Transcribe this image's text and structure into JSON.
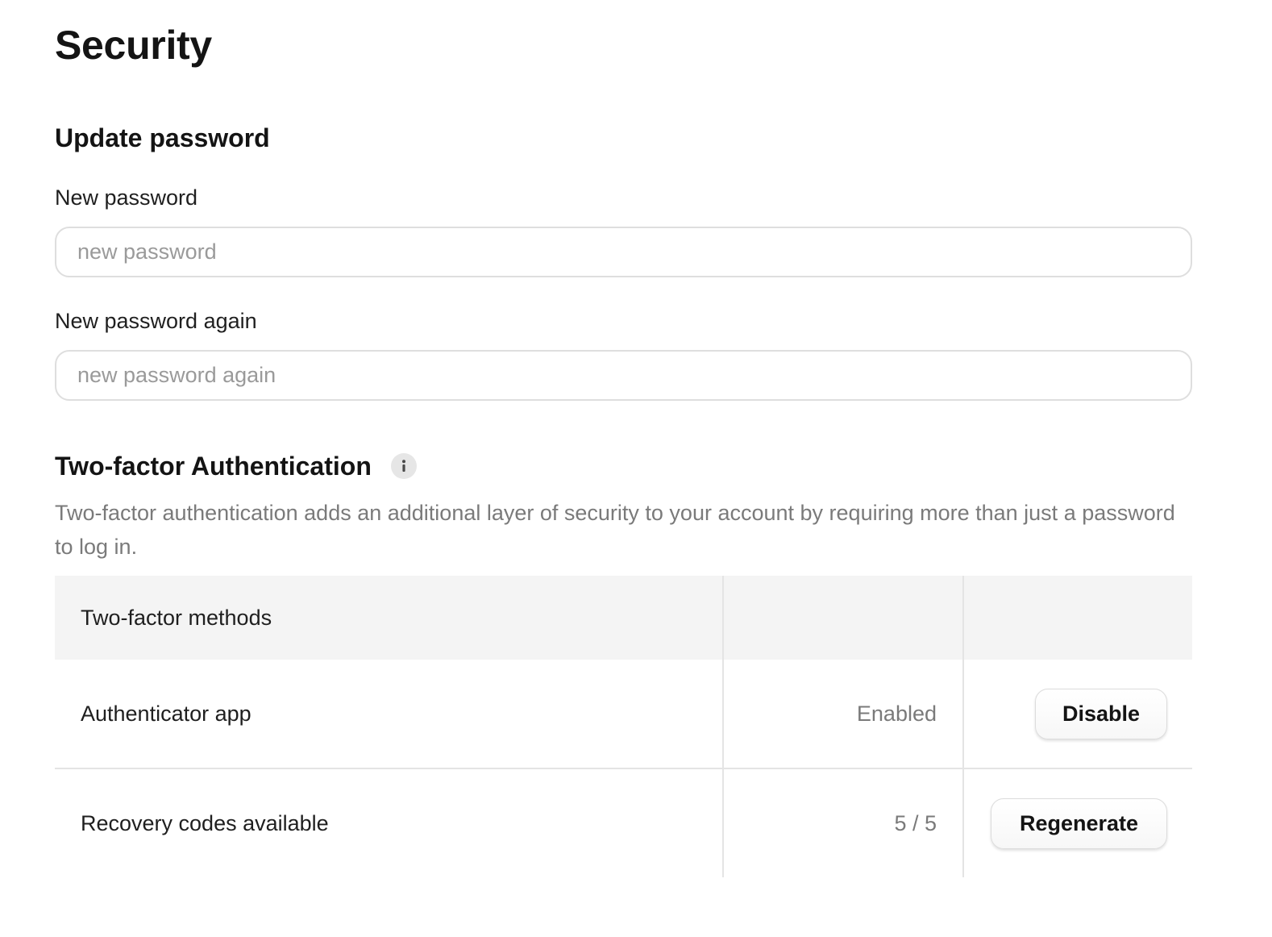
{
  "page": {
    "title": "Security"
  },
  "update_password": {
    "heading": "Update password",
    "new_password": {
      "label": "New password",
      "placeholder": "new password",
      "value": ""
    },
    "new_password_again": {
      "label": "New password again",
      "placeholder": "new password again",
      "value": ""
    }
  },
  "two_factor": {
    "heading": "Two-factor Authentication",
    "info_icon": "info-icon",
    "description": "Two-factor authentication adds an additional layer of security to your account by requiring more than just a password to log in.",
    "table": {
      "header": "Two-factor methods",
      "rows": [
        {
          "name": "Authenticator app",
          "status": "Enabled",
          "action": "Disable"
        },
        {
          "name": "Recovery codes available",
          "status": "5 / 5",
          "action": "Regenerate"
        }
      ]
    }
  },
  "colors": {
    "text_primary": "#141414",
    "text_muted": "#7a7a7a",
    "border": "#dedede",
    "table_header_bg": "#f4f4f4",
    "info_icon_bg": "#e6e6e6"
  }
}
